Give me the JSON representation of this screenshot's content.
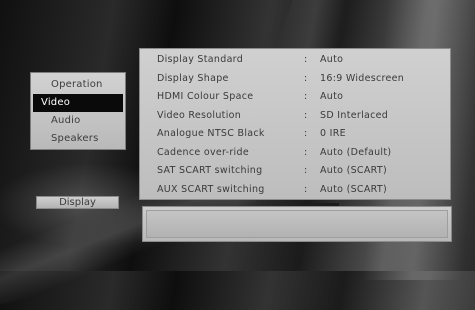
{
  "side_menu": {
    "items": [
      {
        "label": "Operation",
        "selected": false
      },
      {
        "label": "Video",
        "selected": true
      },
      {
        "label": "Audio",
        "selected": false
      },
      {
        "label": "Speakers",
        "selected": false
      }
    ]
  },
  "display_button": {
    "label": "Display"
  },
  "settings": {
    "separator": ":",
    "rows": [
      {
        "label": "Display Standard",
        "value": "Auto"
      },
      {
        "label": "Display Shape",
        "value": "16:9 Widescreen"
      },
      {
        "label": "HDMI Colour Space",
        "value": "Auto"
      },
      {
        "label": "Video Resolution",
        "value": "SD Interlaced"
      },
      {
        "label": "Analogue NTSC Black",
        "value": "0 IRE"
      },
      {
        "label": "Cadence over-ride",
        "value": "Auto (Default)"
      },
      {
        "label": "SAT SCART switching",
        "value": "Auto (SCART)"
      },
      {
        "label": "AUX SCART switching",
        "value": "Auto (SCART)"
      }
    ]
  },
  "info_panel": {
    "text": ""
  },
  "colors": {
    "selected_bg": "#0a0a0a",
    "panel_bg": "#c8c8c8",
    "text": "#3a3a3a"
  }
}
